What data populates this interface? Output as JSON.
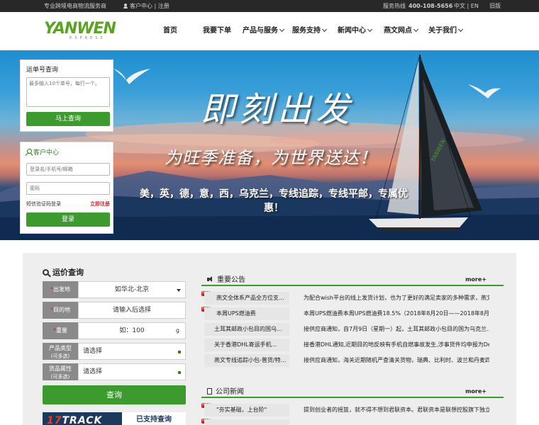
{
  "topbar": {
    "tagline": "专业跨境电商物流服务商",
    "user_links": "客户中心 | 注册",
    "hotline_label": "服务热线",
    "hotline_number": "400-108-5656",
    "lang": "中文 | EN",
    "old_site": "旧版"
  },
  "logo": {
    "brand": "YANWEN",
    "sub": "EXPRESS"
  },
  "nav": [
    {
      "label": "首页",
      "dropdown": false
    },
    {
      "label": "我要下单",
      "dropdown": false
    },
    {
      "label": "产品与服务",
      "dropdown": true
    },
    {
      "label": "服务支持",
      "dropdown": true
    },
    {
      "label": "新闻中心",
      "dropdown": true
    },
    {
      "label": "燕文网点",
      "dropdown": true
    },
    {
      "label": "关于我们",
      "dropdown": true
    }
  ],
  "banner": {
    "slogan": "即刻出发",
    "subtitle": "为旺季准备，为世界送达！",
    "features": "美，英，德，意，西，乌克兰，专线追踪，专线平邮，专属优惠！"
  },
  "tracking": {
    "title": "运单号查询",
    "placeholder": "最多输入10个单号，每行一个。",
    "button": "马上查询"
  },
  "customer": {
    "title": "客户中心",
    "username_placeholder": "登录名/手机号/邮箱",
    "password_placeholder": "密码",
    "sms_login": "短信验证码登录",
    "register": "立即注册",
    "login_button": "登录"
  },
  "rate": {
    "title": "运价查询",
    "origin_label": "出发地",
    "origin_value": "如华北-北京",
    "destination_label": "目的地",
    "destination_value": "请输入后选择",
    "weight_label": "重量",
    "weight_value": "如：100",
    "weight_unit": "g",
    "product_type_label": "产品类型",
    "goods_attr_label": "货品属性",
    "multi_select": "(可多选)",
    "select_placeholder": "请选择",
    "query_button": "查询",
    "track17_logo_a": "17",
    "track17_logo_b": "TRACK",
    "track17_text": "已支持查询"
  },
  "notices": {
    "title": "重要公告",
    "more": "more+",
    "hot_badge": "HOT",
    "items": [
      {
        "title": "燕文全体系产品全方位支...",
        "summary": "为配合wish平台的线上发货计划，也为了更好的满足卖家的多种需求，燕文...",
        "hot": true
      },
      {
        "title": "本周UPS燃油费",
        "summary": "本周UPS燃油费本周UPS燃油费18.5%（2018年8月20日——2018年8月26日...",
        "hot": true
      },
      {
        "title": "土耳其邮政小包目的国乌...",
        "summary": "接供应商通知，自7月9日（星期一）起，土耳其邮政小包目的国为乌克兰...",
        "hot": false
      },
      {
        "title": "关于香港DHL寄运手机...",
        "summary": "接香港DHL通知,近期目的地反映有手机自燃事故发生,涉事货件均申报为Def...",
        "hot": false
      },
      {
        "title": "燕文专线追踪小包-普货/特...",
        "summary": "接供应商通知，海关近期随机严查清关货物，瑞典、比利时、波兰和丹麦四...",
        "hot": false
      }
    ]
  },
  "news": {
    "title": "公司新闻",
    "more": "more+",
    "items": [
      {
        "title": "\"夯实基础，上台阶\"",
        "summary": "提到创业者的摇篮，就不得不想到君联资本。君联资本是联想控股旗下独立...",
        "hot": true
      },
      {
        "title": "",
        "summary": "",
        "hot": true
      }
    ]
  }
}
